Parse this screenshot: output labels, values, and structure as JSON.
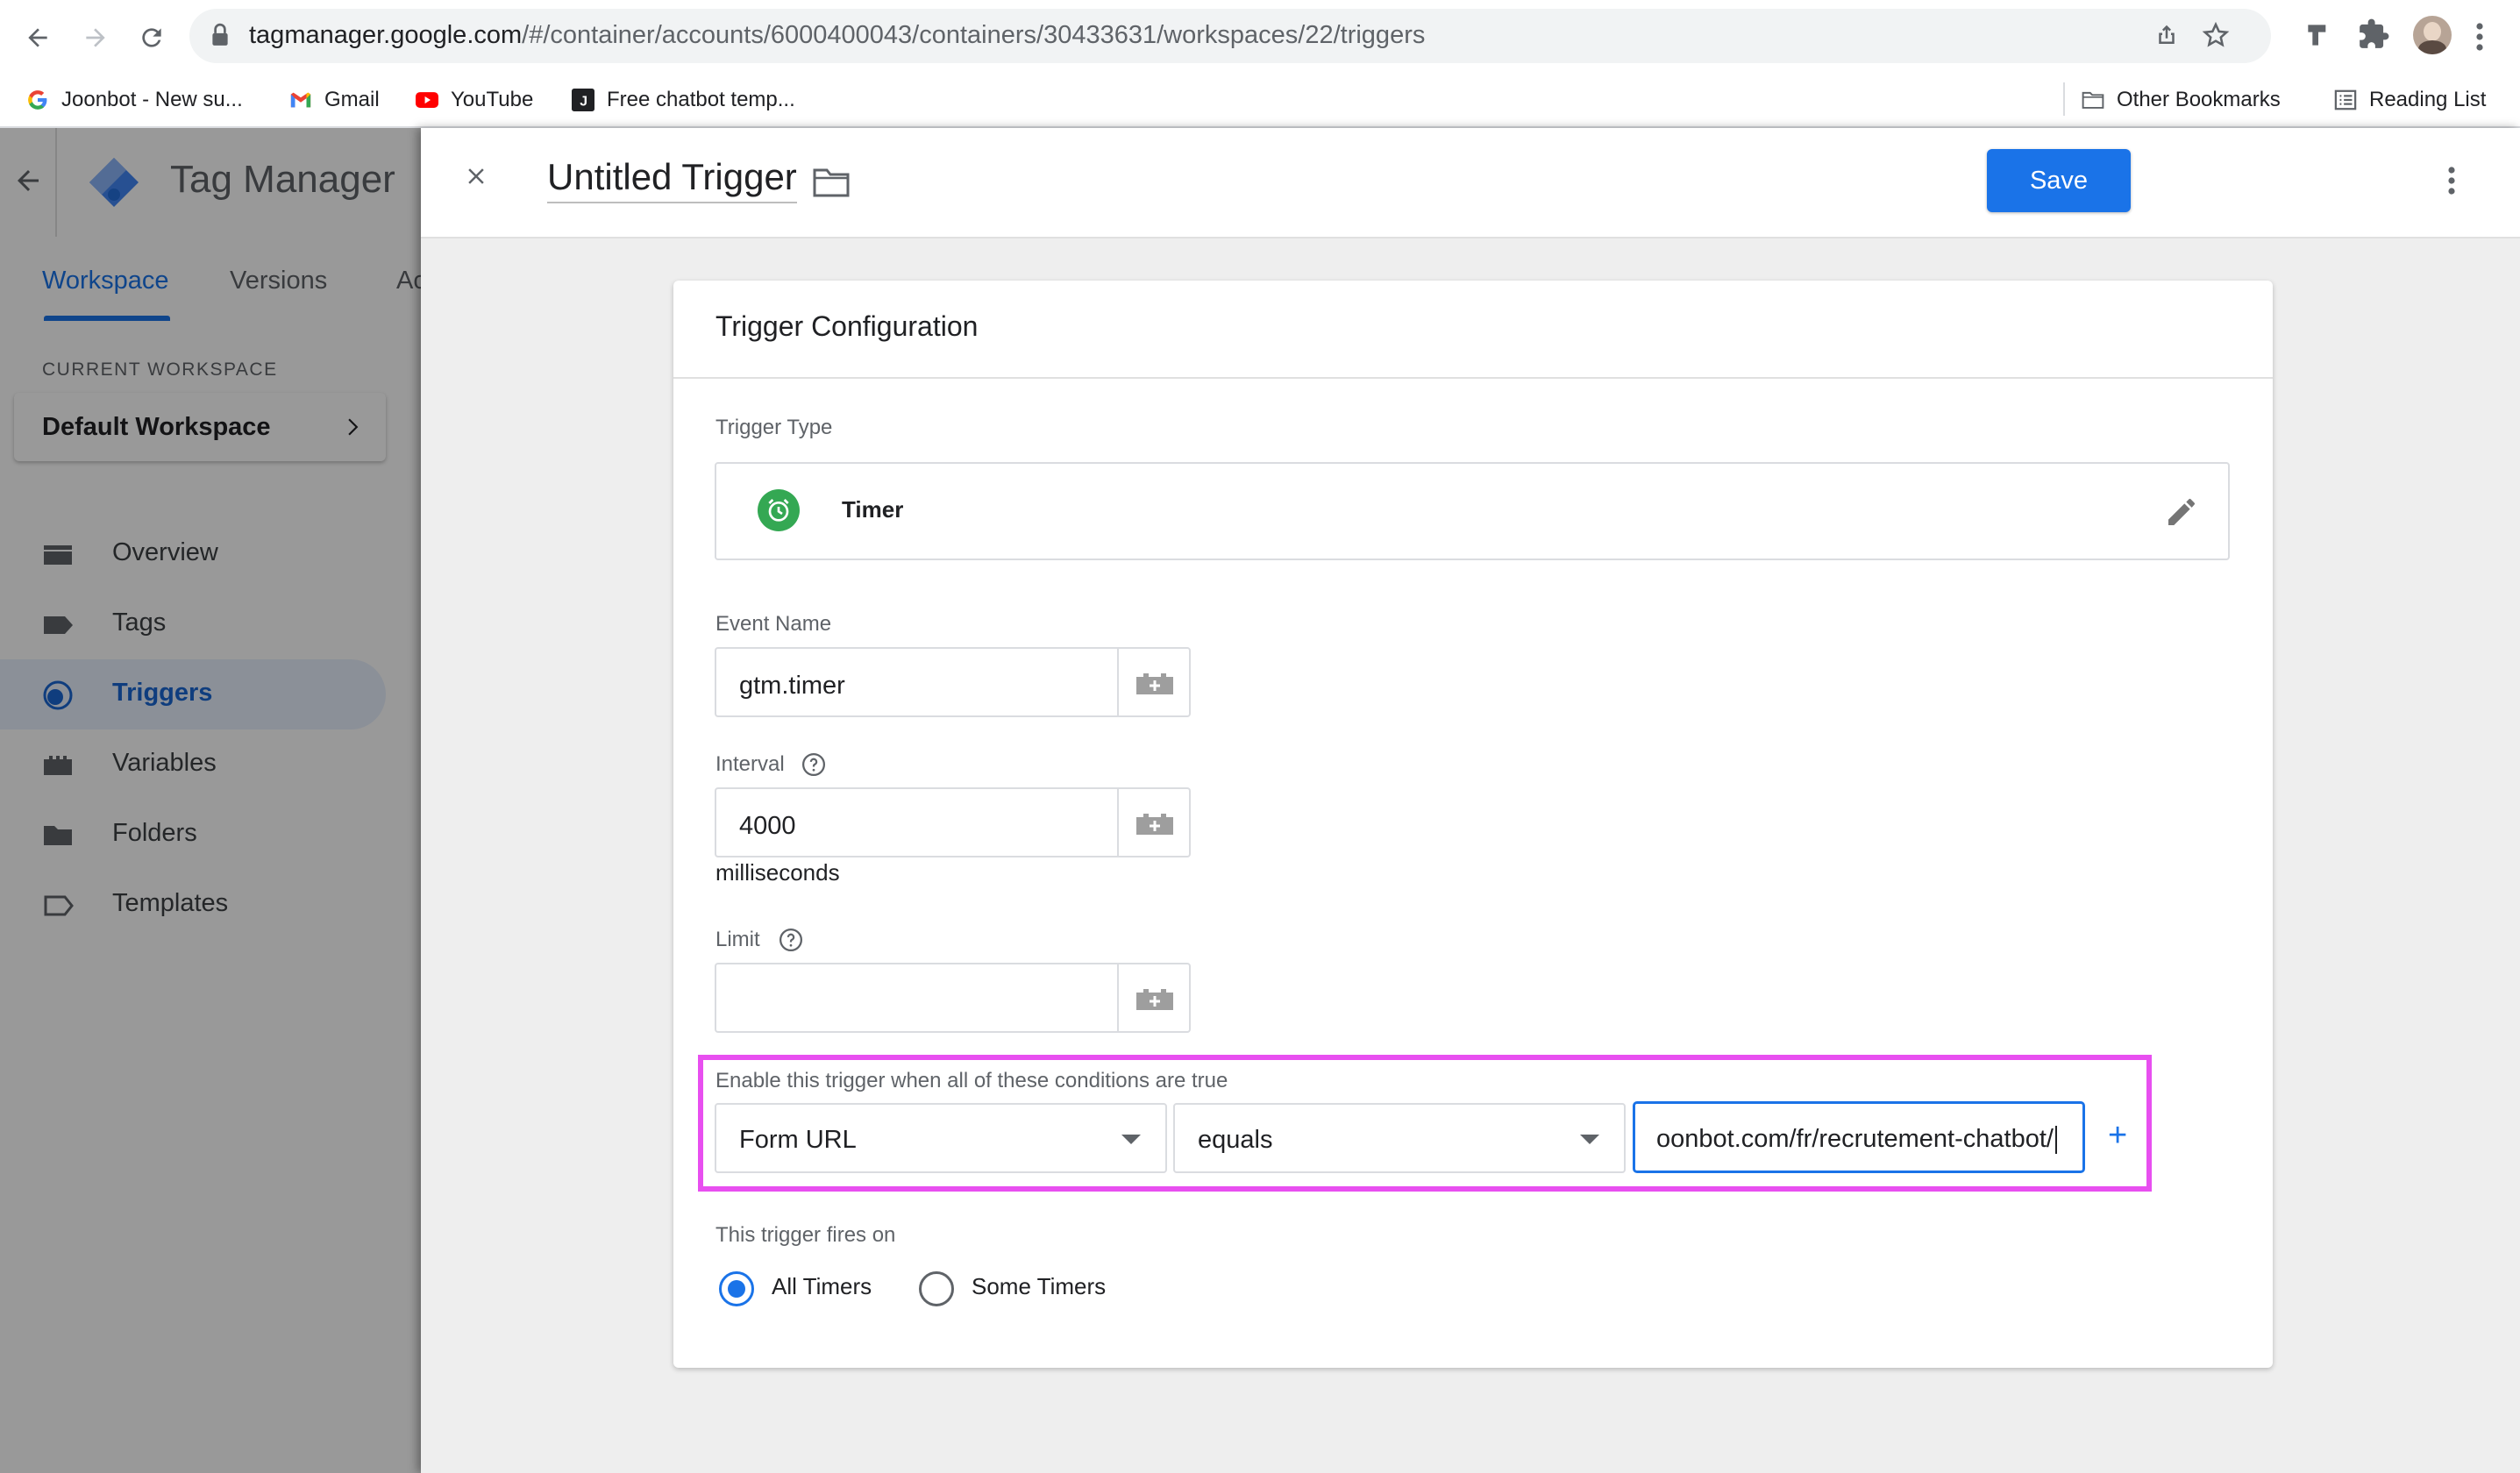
{
  "browser": {
    "url_host": "tagmanager.google.com",
    "url_path": "/#/container/accounts/6000400043/containers/30433631/workspaces/22/triggers"
  },
  "bookmarks": {
    "items": [
      {
        "label": "Joonbot - New su...",
        "icon": "google-g-icon"
      },
      {
        "label": "Gmail",
        "icon": "gmail-icon"
      },
      {
        "label": "YouTube",
        "icon": "youtube-icon"
      },
      {
        "label": "Free chatbot temp...",
        "icon": "joonbot-j-icon"
      }
    ],
    "other": "Other Bookmarks",
    "reading_list": "Reading List"
  },
  "gtm": {
    "title": "Tag Manager",
    "tabs": [
      "Workspace",
      "Versions",
      "Ac"
    ],
    "active_tab": "Workspace"
  },
  "sidebar": {
    "current_workspace_label": "CURRENT WORKSPACE",
    "workspace_name": "Default Workspace",
    "items": [
      {
        "label": "Overview",
        "icon": "overview-icon"
      },
      {
        "label": "Tags",
        "icon": "tag-icon"
      },
      {
        "label": "Triggers",
        "icon": "trigger-icon"
      },
      {
        "label": "Variables",
        "icon": "variables-icon"
      },
      {
        "label": "Folders",
        "icon": "folder-icon"
      },
      {
        "label": "Templates",
        "icon": "template-icon"
      }
    ],
    "active": "Triggers"
  },
  "panel": {
    "title": "Untitled Trigger",
    "save_label": "Save"
  },
  "trigger": {
    "section_title": "Trigger Configuration",
    "type_label": "Trigger Type",
    "type_name": "Timer",
    "event_name_label": "Event Name",
    "event_name_value": "gtm.timer",
    "interval_label": "Interval",
    "interval_value": "4000",
    "interval_unit": "milliseconds",
    "limit_label": "Limit",
    "limit_value": "",
    "conditions_label": "Enable this trigger when all of these conditions are true",
    "condition": {
      "variable": "Form URL",
      "operator": "equals",
      "value": "oonbot.com/fr/recrutement-chatbot/"
    },
    "fires_on_label": "This trigger fires on",
    "fires_on_options": [
      "All Timers",
      "Some Timers"
    ],
    "fires_on_selected": "All Timers"
  },
  "colors": {
    "accent": "#1a73e8",
    "highlight": "#e84ff0",
    "timer_green": "#34a853"
  }
}
